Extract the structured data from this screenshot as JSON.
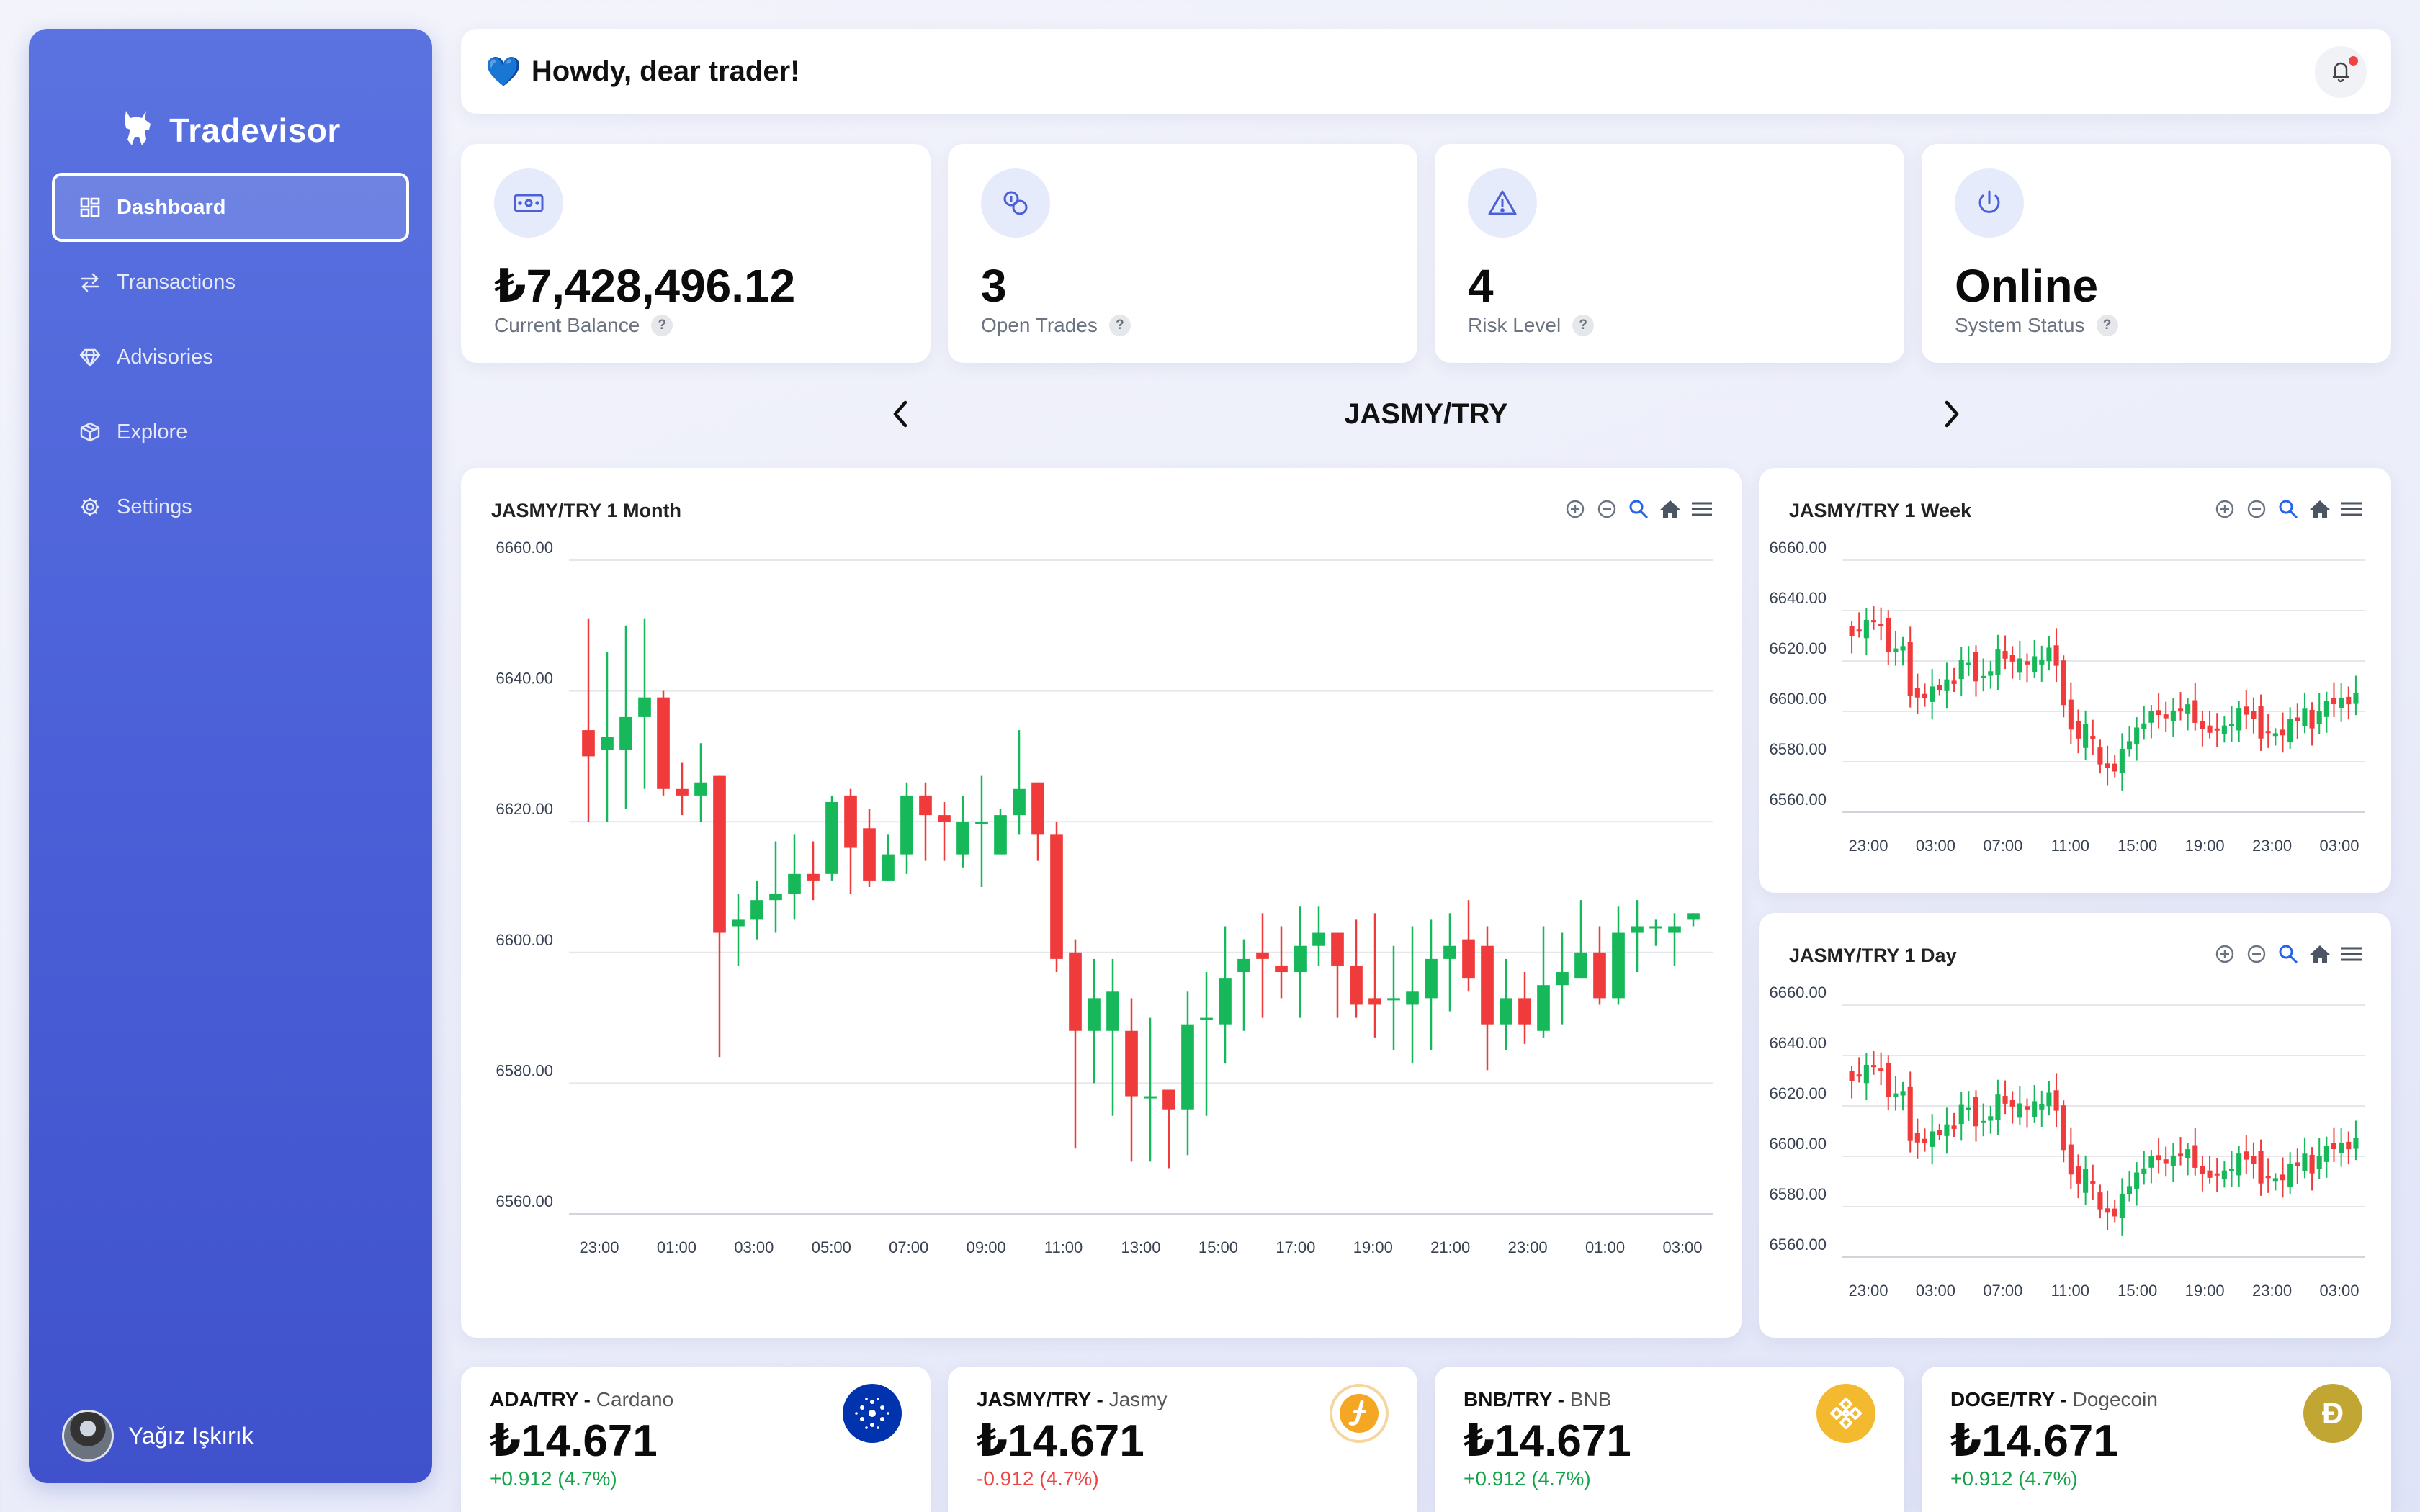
{
  "app": {
    "brand": "Tradevisor"
  },
  "sidebar": {
    "items": [
      {
        "label": "Dashboard",
        "icon": "dashboard-icon",
        "active": true
      },
      {
        "label": "Transactions",
        "icon": "transactions-icon",
        "active": false
      },
      {
        "label": "Advisories",
        "icon": "diamond-icon",
        "active": false
      },
      {
        "label": "Explore",
        "icon": "cube-icon",
        "active": false
      },
      {
        "label": "Settings",
        "icon": "gear-icon",
        "active": false
      }
    ],
    "user": {
      "name": "Yağız Işkırık"
    }
  },
  "header": {
    "greeting": "Howdy, dear trader!",
    "emoji": "💙"
  },
  "stats": [
    {
      "value": "₺7,428,496.12",
      "label": "Current Balance",
      "icon": "cash-icon"
    },
    {
      "value": "3",
      "label": "Open Trades",
      "icon": "coins-icon"
    },
    {
      "value": "4",
      "label": "Risk Level",
      "icon": "warning-icon"
    },
    {
      "value": "Online",
      "label": "System Status",
      "icon": "power-icon"
    }
  ],
  "pair": {
    "title": "JASMY/TRY"
  },
  "charts": {
    "month": {
      "title": "JASMY/TRY 1 Month"
    },
    "week": {
      "title": "JASMY/TRY 1 Week"
    },
    "day": {
      "title": "JASMY/TRY 1 Day"
    }
  },
  "chart_data": [
    {
      "type": "candlestick",
      "title": "JASMY/TRY 1 Month",
      "ylim": [
        6560,
        6660
      ],
      "yticks": [
        "6660.00",
        "6640.00",
        "6620.00",
        "6600.00",
        "6580.00",
        "6560.00"
      ],
      "xticks": [
        "23:00",
        "01:00",
        "03:00",
        "05:00",
        "07:00",
        "09:00",
        "11:00",
        "13:00",
        "15:00",
        "17:00",
        "19:00",
        "21:00",
        "23:00",
        "01:00",
        "03:00"
      ],
      "candles": [
        [
          6634,
          6630,
          6651,
          6620
        ],
        [
          6631,
          6633,
          6646,
          6620
        ],
        [
          6631,
          6636,
          6650,
          6622
        ],
        [
          6636,
          6639,
          6651,
          6625
        ],
        [
          6639,
          6625,
          6640,
          6624
        ],
        [
          6625,
          6624,
          6629,
          6621
        ],
        [
          6624,
          6626,
          6632,
          6620
        ],
        [
          6627,
          6603,
          6627,
          6584
        ],
        [
          6604,
          6605,
          6609,
          6598
        ],
        [
          6605,
          6608,
          6611,
          6602
        ],
        [
          6608,
          6609,
          6617,
          6603
        ],
        [
          6609,
          6612,
          6618,
          6605
        ],
        [
          6612,
          6611,
          6617,
          6608
        ],
        [
          6612,
          6623,
          6624,
          6611
        ],
        [
          6624,
          6616,
          6625,
          6609
        ],
        [
          6619,
          6611,
          6622,
          6610
        ],
        [
          6611,
          6615,
          6618,
          6611
        ],
        [
          6615,
          6624,
          6626,
          6612
        ],
        [
          6624,
          6621,
          6626,
          6614
        ],
        [
          6621,
          6620,
          6623,
          6614
        ],
        [
          6615,
          6620,
          6624,
          6613
        ],
        [
          6620,
          6620,
          6627,
          6610
        ],
        [
          6615,
          6621,
          6622,
          6615
        ],
        [
          6621,
          6625,
          6634,
          6618
        ],
        [
          6626,
          6618,
          6626,
          6614
        ],
        [
          6618,
          6599,
          6620,
          6597
        ],
        [
          6600,
          6588,
          6602,
          6570
        ],
        [
          6588,
          6593,
          6599,
          6580
        ],
        [
          6588,
          6594,
          6599,
          6575
        ],
        [
          6588,
          6578,
          6593,
          6568
        ],
        [
          6578,
          6578,
          6590,
          6568
        ],
        [
          6579,
          6576,
          6579,
          6567
        ],
        [
          6576,
          6589,
          6594,
          6569
        ],
        [
          6590,
          6590,
          6597,
          6575
        ],
        [
          6589,
          6596,
          6604,
          6583
        ],
        [
          6597,
          6599,
          6602,
          6588
        ],
        [
          6600,
          6599,
          6606,
          6590
        ],
        [
          6598,
          6597,
          6604,
          6593
        ],
        [
          6597,
          6601,
          6607,
          6590
        ],
        [
          6601,
          6603,
          6607,
          6598
        ],
        [
          6603,
          6598,
          6600,
          6590
        ],
        [
          6598,
          6592,
          6605,
          6590
        ],
        [
          6593,
          6592,
          6606,
          6587
        ],
        [
          6593,
          6593,
          6601,
          6585
        ],
        [
          6592,
          6594,
          6604,
          6583
        ],
        [
          6593,
          6599,
          6605,
          6585
        ],
        [
          6599,
          6601,
          6606,
          6591
        ],
        [
          6602,
          6596,
          6608,
          6594
        ],
        [
          6601,
          6589,
          6604,
          6582
        ],
        [
          6589,
          6593,
          6599,
          6585
        ],
        [
          6593,
          6589,
          6597,
          6586
        ],
        [
          6588,
          6595,
          6604,
          6587
        ],
        [
          6595,
          6597,
          6603,
          6589
        ],
        [
          6596,
          6600,
          6608,
          6596
        ],
        [
          6600,
          6593,
          6604,
          6592
        ],
        [
          6593,
          6603,
          6607,
          6592
        ],
        [
          6603,
          6604,
          6608,
          6597
        ],
        [
          6604,
          6604,
          6605,
          6601
        ],
        [
          6603,
          6604,
          6606,
          6598
        ],
        [
          6605,
          6606,
          6606,
          6604
        ]
      ]
    },
    {
      "type": "candlestick",
      "title": "JASMY/TRY 1 Week",
      "ylim": [
        6560,
        6660
      ],
      "yticks": [
        "6660.00",
        "6640.00",
        "6620.00",
        "6600.00",
        "6580.00",
        "6560.00"
      ],
      "xticks": [
        "23:00",
        "03:00",
        "07:00",
        "11:00",
        "15:00",
        "19:00",
        "23:00",
        "03:00"
      ]
    },
    {
      "type": "candlestick",
      "title": "JASMY/TRY 1 Day",
      "ylim": [
        6560,
        6660
      ],
      "yticks": [
        "6660.00",
        "6640.00",
        "6620.00",
        "6600.00",
        "6580.00",
        "6560.00"
      ],
      "xticks": [
        "23:00",
        "03:00",
        "07:00",
        "11:00",
        "15:00",
        "19:00",
        "23:00",
        "03:00"
      ]
    }
  ],
  "tickers": [
    {
      "pair": "ADA/TRY",
      "name": "Cardano",
      "price": "₺14.671",
      "change": "+0.912 (4.7%)",
      "direction": "up",
      "color": "#0033ad",
      "icon": "cardano-icon"
    },
    {
      "pair": "JASMY/TRY",
      "name": "Jasmy",
      "price": "₺14.671",
      "change": "-0.912 (4.7%)",
      "direction": "down",
      "color": "#f5a623",
      "icon": "jasmy-icon"
    },
    {
      "pair": "BNB/TRY",
      "name": "BNB",
      "price": "₺14.671",
      "change": "+0.912 (4.7%)",
      "direction": "up",
      "color": "#f3ba2f",
      "icon": "bnb-icon"
    },
    {
      "pair": "DOGE/TRY",
      "name": "Dogecoin",
      "price": "₺14.671",
      "change": "+0.912 (4.7%)",
      "direction": "up",
      "color": "#c2a633",
      "icon": "doge-icon"
    }
  ],
  "colors": {
    "bull": "#16b85a",
    "bear": "#ef3b3b",
    "accent": "#5a73e0"
  }
}
